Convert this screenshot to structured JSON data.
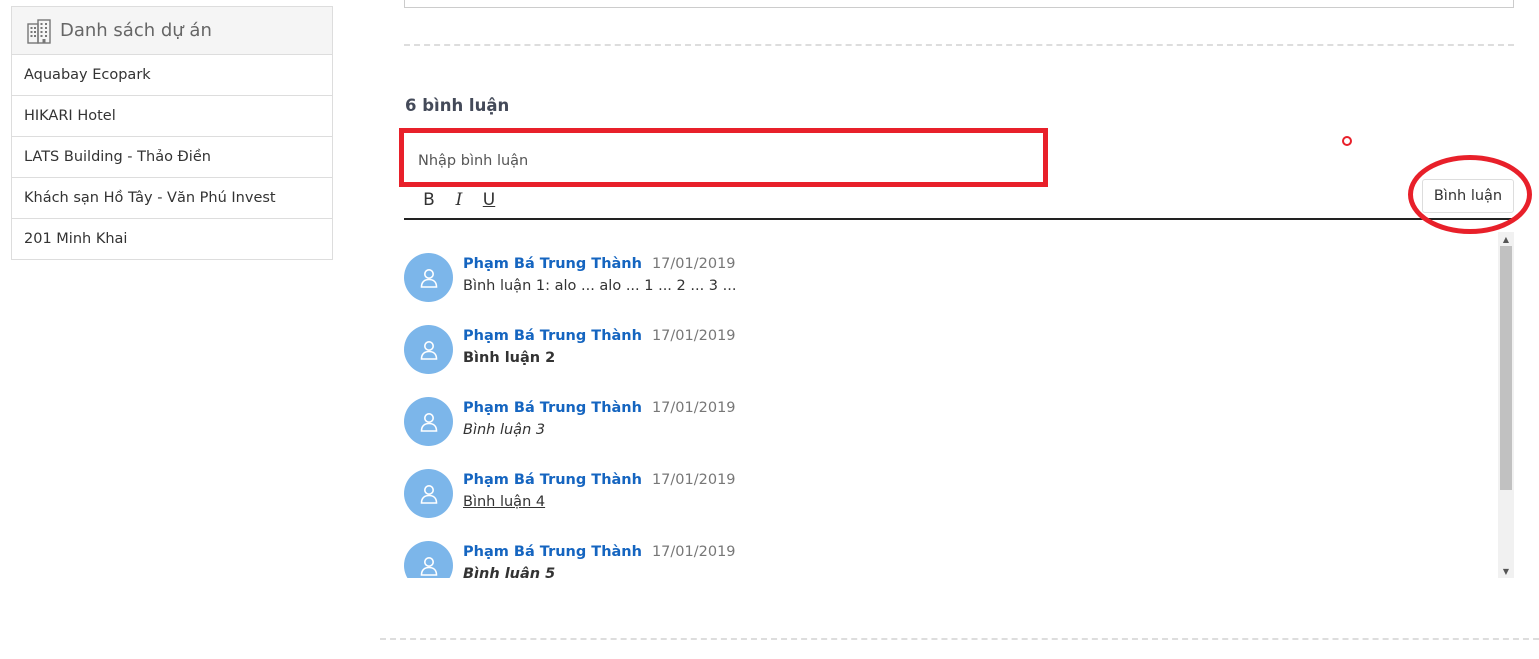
{
  "sidebar": {
    "header_icon": "building-icon",
    "title": "Danh sách dự án",
    "items": [
      {
        "label": "Aquabay Ecopark"
      },
      {
        "label": "HIKARI Hotel"
      },
      {
        "label": "LATS Building - Thảo Điền"
      },
      {
        "label": "Khách sạn Hồ Tây - Văn Phú Invest"
      },
      {
        "label": "201 Minh Khai"
      }
    ]
  },
  "comments_section": {
    "count_label": "6 bình luận",
    "input_placeholder": "Nhập bình luận",
    "toolbar": {
      "bold": "B",
      "italic": "I",
      "underline": "U"
    },
    "submit_label": "Bình luận",
    "highlight_color": "#e8202a"
  },
  "comments": [
    {
      "author": "Phạm Bá Trung Thành",
      "date": "17/01/2019",
      "text": "Bình luận 1: alo ... alo ... 1 ... 2 ... 3 ...",
      "format": "normal"
    },
    {
      "author": "Phạm Bá Trung Thành",
      "date": "17/01/2019",
      "text": "Bình luận 2",
      "format": "bold"
    },
    {
      "author": "Phạm Bá Trung Thành",
      "date": "17/01/2019",
      "text": "Bình luận 3",
      "format": "italic"
    },
    {
      "author": "Phạm Bá Trung Thành",
      "date": "17/01/2019",
      "text": "Bình luận 4",
      "format": "underline"
    },
    {
      "author": "Phạm Bá Trung Thành",
      "date": "17/01/2019",
      "text": "Bình luận 5",
      "format": "bolditalic"
    }
  ],
  "colors": {
    "author_link": "#1565c0",
    "avatar_bg": "#7cb6ea"
  }
}
